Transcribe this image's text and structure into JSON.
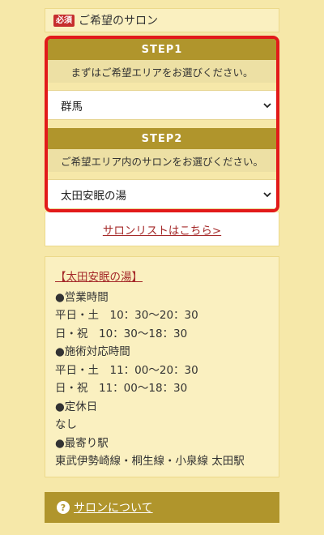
{
  "header": {
    "badge": "必須",
    "title": "ご希望のサロン"
  },
  "step1": {
    "title": "STEP1",
    "description": "まずはご希望エリアをお選びください。",
    "selected": "群馬"
  },
  "step2": {
    "title": "STEP2",
    "description": "ご希望エリア内のサロンをお選びください。",
    "selected": "太田安眠の湯"
  },
  "salon_list_link": "サロンリストはこちら>",
  "info": {
    "name": "【太田安眠の湯】",
    "lines": [
      "●営業時間",
      "平日・土　10：30〜20：30",
      "日・祝　10：30〜18：30",
      "●施術対応時間",
      "平日・土　11：00〜20：30",
      "日・祝　11：00〜18：30",
      "●定休日",
      "なし",
      "●最寄り駅",
      "東武伊勢崎線・桐生線・小泉線 太田駅"
    ]
  },
  "about": {
    "icon": "question-icon",
    "label": "サロンについて"
  },
  "colors": {
    "background": "#f6e8a9",
    "accent": "#b0952c",
    "highlight_border": "#e21a1a",
    "link": "#a52a2a"
  }
}
